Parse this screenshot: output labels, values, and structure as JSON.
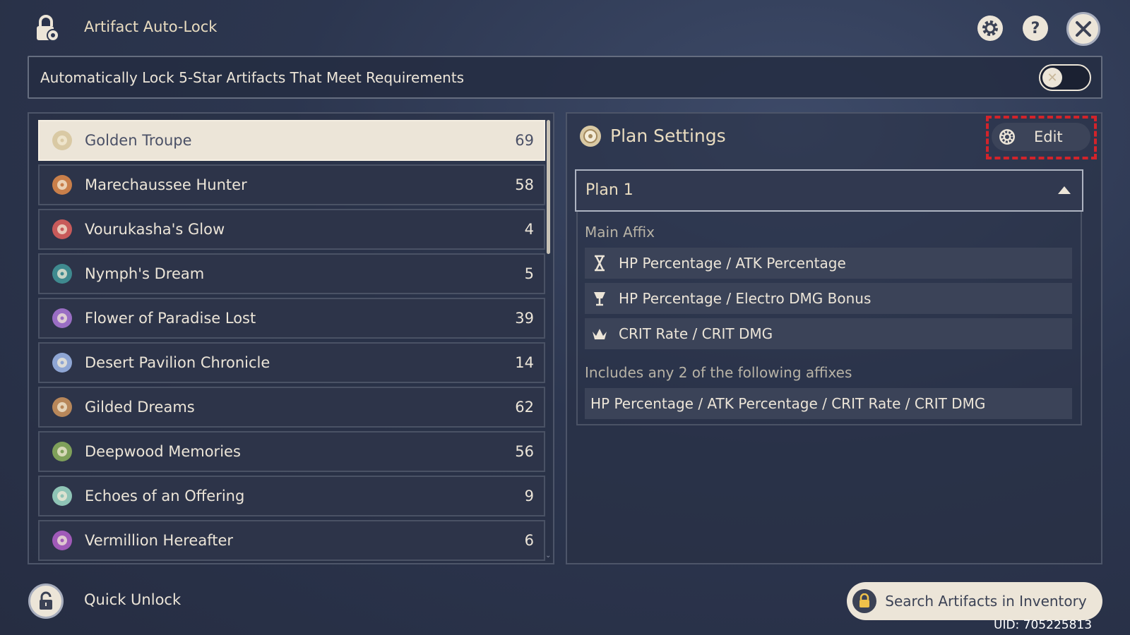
{
  "header": {
    "title": "Artifact Auto-Lock",
    "icons": [
      "lock-settings-icon",
      "gear-icon",
      "help-icon",
      "close-icon"
    ]
  },
  "auto_lock": {
    "label": "Automatically Lock 5-Star Artifacts That Meet Requirements",
    "enabled": false
  },
  "artifact_sets": [
    {
      "name": "Golden Troupe",
      "count": "69",
      "selected": true
    },
    {
      "name": "Marechaussee Hunter",
      "count": "58"
    },
    {
      "name": "Vourukasha's Glow",
      "count": "4"
    },
    {
      "name": "Nymph's Dream",
      "count": "5"
    },
    {
      "name": "Flower of Paradise Lost",
      "count": "39"
    },
    {
      "name": "Desert Pavilion Chronicle",
      "count": "14"
    },
    {
      "name": "Gilded Dreams",
      "count": "62"
    },
    {
      "name": "Deepwood Memories",
      "count": "56"
    },
    {
      "name": "Echoes of an Offering",
      "count": "9"
    },
    {
      "name": "Vermillion Hereafter",
      "count": "6"
    }
  ],
  "plan": {
    "title": "Plan Settings",
    "edit_label": "Edit",
    "selected_plan": "Plan 1",
    "main_affix_label": "Main Affix",
    "main_affixes": [
      {
        "slot_icon": "sands-hourglass-icon",
        "text": "HP Percentage / ATK Percentage"
      },
      {
        "slot_icon": "goblet-icon",
        "text": "HP Percentage / Electro DMG Bonus"
      },
      {
        "slot_icon": "circlet-icon",
        "text": "CRIT Rate / CRIT DMG"
      }
    ],
    "sub_affix_label": "Includes any 2 of the following affixes",
    "sub_affixes": "HP Percentage / ATK Percentage / CRIT Rate / CRIT DMG"
  },
  "footer": {
    "quick_unlock": "Quick Unlock",
    "search_button": "Search Artifacts in Inventory",
    "uid": "UID: 705225813"
  },
  "colors": {
    "accent_cream": "#ece5d8",
    "highlight_red": "#d3232a",
    "panel_bg": "#2d3449"
  }
}
